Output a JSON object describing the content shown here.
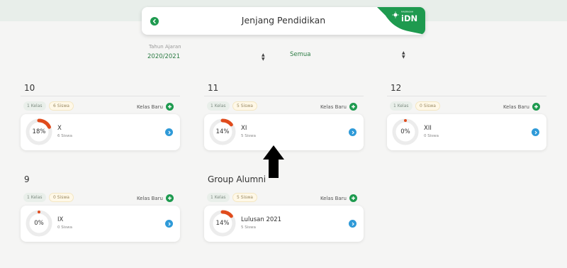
{
  "header": {
    "title": "Jenjang Pendidikan",
    "brand_small": "MADRASAH",
    "brand_name": "iDN"
  },
  "filters": {
    "year_label": "Tahun Ajaran",
    "year_value": "2020/2021",
    "type_value": "Semua"
  },
  "colors": {
    "accent": "#1e9a4f",
    "progress": "#e04b1c",
    "info": "#2f9ad8"
  },
  "kelas_baru_label": "Kelas Baru",
  "sections": [
    {
      "title": "10",
      "kelas_chip": "1 Kelas",
      "siswa_chip": "6 Siswa",
      "card": {
        "percent": "18%",
        "progress": 0.18,
        "name": "X",
        "sub": "6 Siswa"
      }
    },
    {
      "title": "11",
      "kelas_chip": "1 Kelas",
      "siswa_chip": "5 Siswa",
      "card": {
        "percent": "14%",
        "progress": 0.14,
        "name": "XI",
        "sub": "5 Siswa"
      }
    },
    {
      "title": "12",
      "kelas_chip": "1 Kelas",
      "siswa_chip": "0 Siswa",
      "card": {
        "percent": "0%",
        "progress": 0,
        "name": "XII",
        "sub": "0 Siswa"
      }
    },
    {
      "title": "9",
      "kelas_chip": "1 Kelas",
      "siswa_chip": "0 Siswa",
      "card": {
        "percent": "0%",
        "progress": 0,
        "name": "IX",
        "sub": "0 Siswa"
      }
    },
    {
      "title": "Group Alumni",
      "kelas_chip": "1 Kelas",
      "siswa_chip": "5 Siswa",
      "card": {
        "percent": "14%",
        "progress": 0.14,
        "name": "Lulusan 2021",
        "sub": "5 Siswa"
      }
    }
  ]
}
